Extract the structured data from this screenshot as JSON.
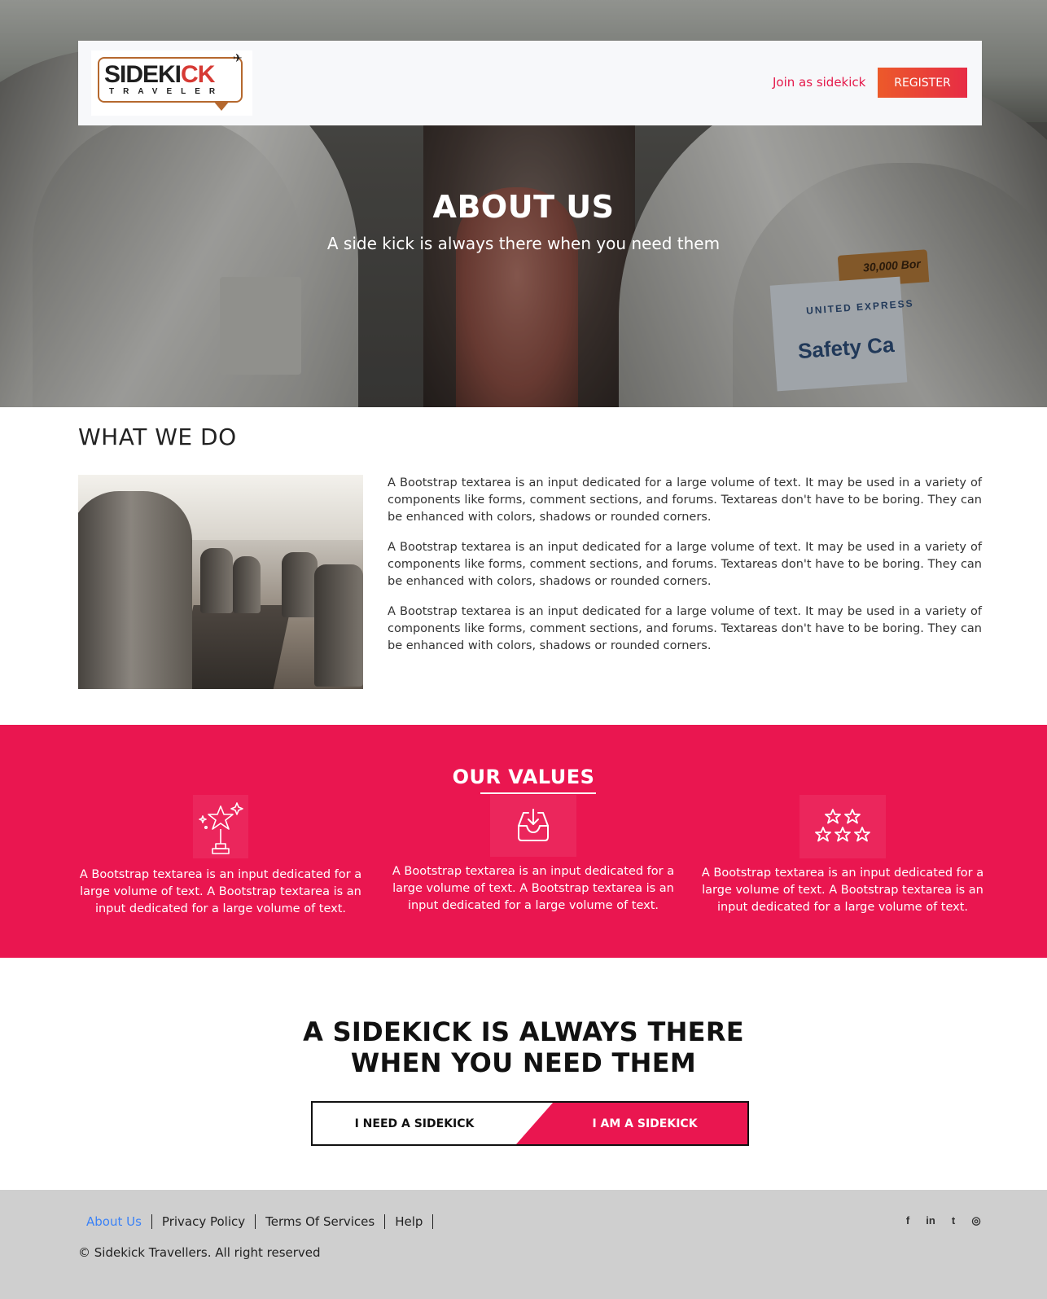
{
  "brand": {
    "logo_main_a": "SIDEKI",
    "logo_main_k": "CK",
    "logo_sub": "TRAVELER",
    "plane_glyph": "✈"
  },
  "nav": {
    "join_label": "Join as sidekick",
    "register_label": "REGISTER"
  },
  "hero": {
    "title": "ABOUT US",
    "subtitle": "A side kick is always there when you need them",
    "seat_card_text": "Safety Ca",
    "seat_card_brand": "UNITED EXPRESS",
    "seat_card_tab": "30,000 Bor"
  },
  "what_we_do": {
    "title": "WHAT WE DO",
    "paragraphs": [
      "A Bootstrap textarea is an input dedicated for a large volume of text. It may be used in a variety of components like forms, comment sections, and forums. Textareas don't have to be boring. They can be enhanced with colors, shadows or rounded corners.",
      "A Bootstrap textarea is an input dedicated for a large volume of text. It may be used in a variety of components like forms, comment sections, and forums. Textareas don't have to be boring. They can be enhanced with colors, shadows or rounded corners.",
      "A Bootstrap textarea is an input dedicated for a large volume of text. It may be used in a variety of components like forms, comment sections, and forums. Textareas don't have to be boring. They can be enhanced with colors, shadows or rounded corners."
    ]
  },
  "values": {
    "title": "OUR VALUES",
    "items": [
      {
        "icon": "trophy-star-icon",
        "text": "A Bootstrap textarea is an input dedicated for a large volume of text. A Bootstrap textarea is an input dedicated for a large volume of text."
      },
      {
        "icon": "inbox-download-icon",
        "text": "A Bootstrap textarea is an input dedicated for a large volume of text. A Bootstrap textarea is an input dedicated for a large volume of text."
      },
      {
        "icon": "stars-rating-icon",
        "text": "A Bootstrap textarea is an input dedicated for a large volume of text. A Bootstrap textarea is an input dedicated for a large volume of text."
      }
    ]
  },
  "cta": {
    "title_line1": "A SIDEKICK IS ALWAYS THERE",
    "title_line2": "WHEN YOU NEED THEM",
    "need_label": "I NEED A SIDEKICK",
    "am_label": "I AM A SIDEKICK"
  },
  "footer": {
    "links": [
      "About Us",
      "Privacy Policy",
      "Terms Of Services",
      "Help"
    ],
    "active_link": "About Us",
    "copyright": "© Sidekick Travellers. All right reserved",
    "social": [
      {
        "icon": "facebook-icon",
        "glyph": "f"
      },
      {
        "icon": "linkedin-icon",
        "glyph": "in"
      },
      {
        "icon": "twitter-icon",
        "glyph": "t"
      },
      {
        "icon": "instagram-icon",
        "glyph": "◎"
      }
    ]
  },
  "colors": {
    "accent": "#ea1650",
    "register_gradient_start": "#ec5a2a",
    "register_gradient_end": "#e72c45",
    "footer_bg": "#cfcfcf",
    "active_link": "#3b82f6"
  }
}
